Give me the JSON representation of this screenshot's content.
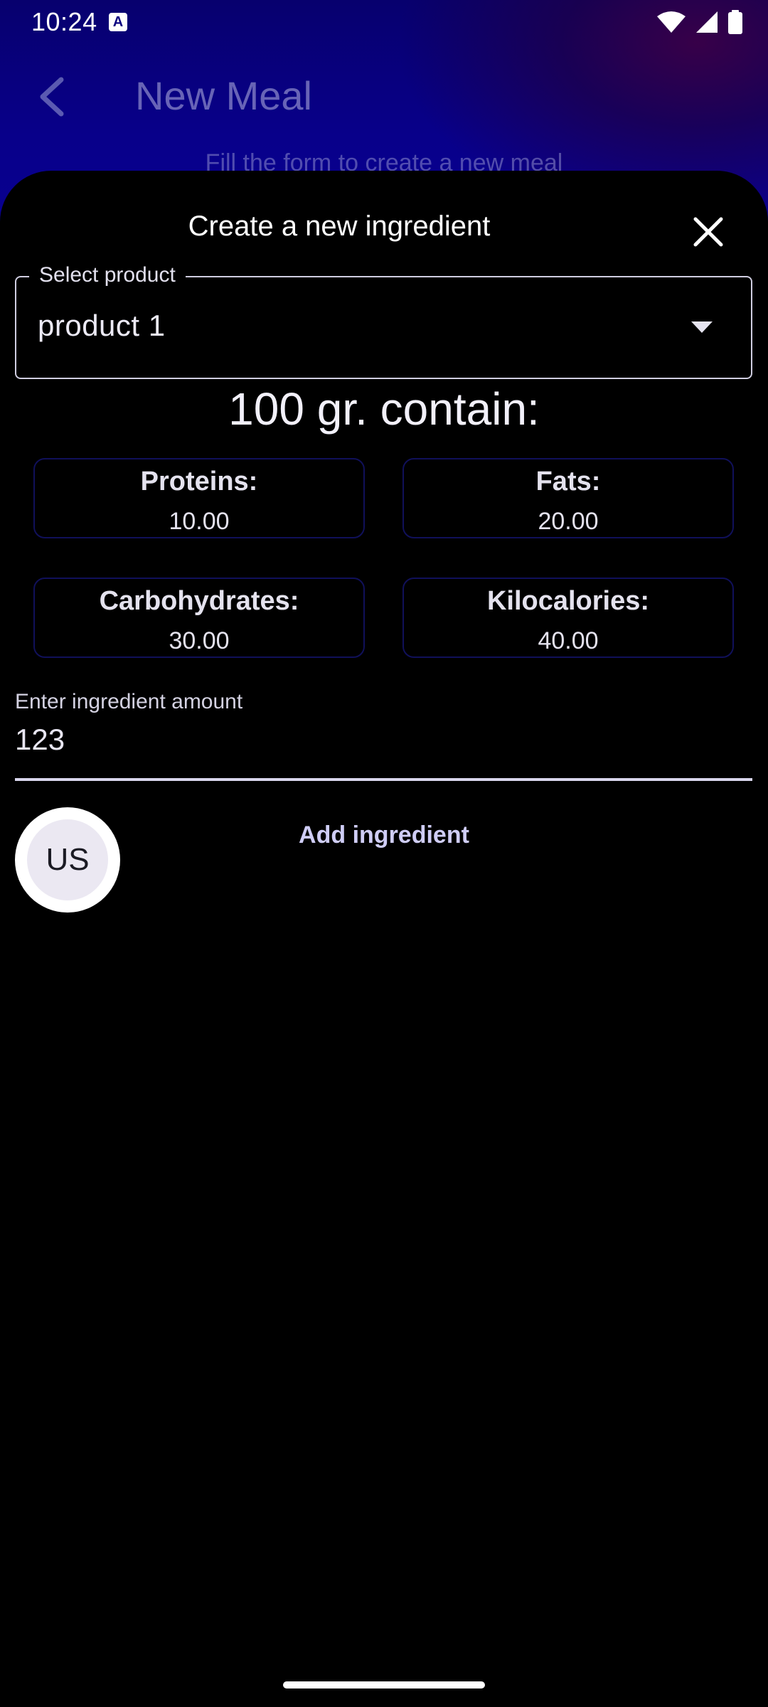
{
  "status_bar": {
    "time": "10:24",
    "notification_icon": "A",
    "icons": [
      "wifi-icon",
      "signal-icon",
      "battery-icon"
    ]
  },
  "app_bar": {
    "title": "New Meal",
    "back_icon": "chevron-left-icon",
    "subtitle": "Fill the form to create a new meal"
  },
  "sheet": {
    "title": "Create a new ingredient",
    "close_icon": "close-icon",
    "product_select": {
      "label": "Select product",
      "value": "product 1",
      "dropdown_icon": "arrow-drop-down-icon"
    },
    "per_amount_heading": "100 gr. contain:",
    "nutrients": [
      {
        "label": "Proteins:",
        "value": "10.00"
      },
      {
        "label": "Fats:",
        "value": "20.00"
      },
      {
        "label": "Carbohydrates:",
        "value": "30.00"
      },
      {
        "label": "Kilocalories:",
        "value": "40.00"
      }
    ],
    "amount_field": {
      "label": "Enter ingredient amount",
      "value": "123"
    },
    "avatar_text": "US",
    "add_button_label": "Add ingredient"
  },
  "colors": {
    "header_gradient": "#08008a",
    "accent_text": "#cfcdf6",
    "card_border": "#10105a"
  }
}
